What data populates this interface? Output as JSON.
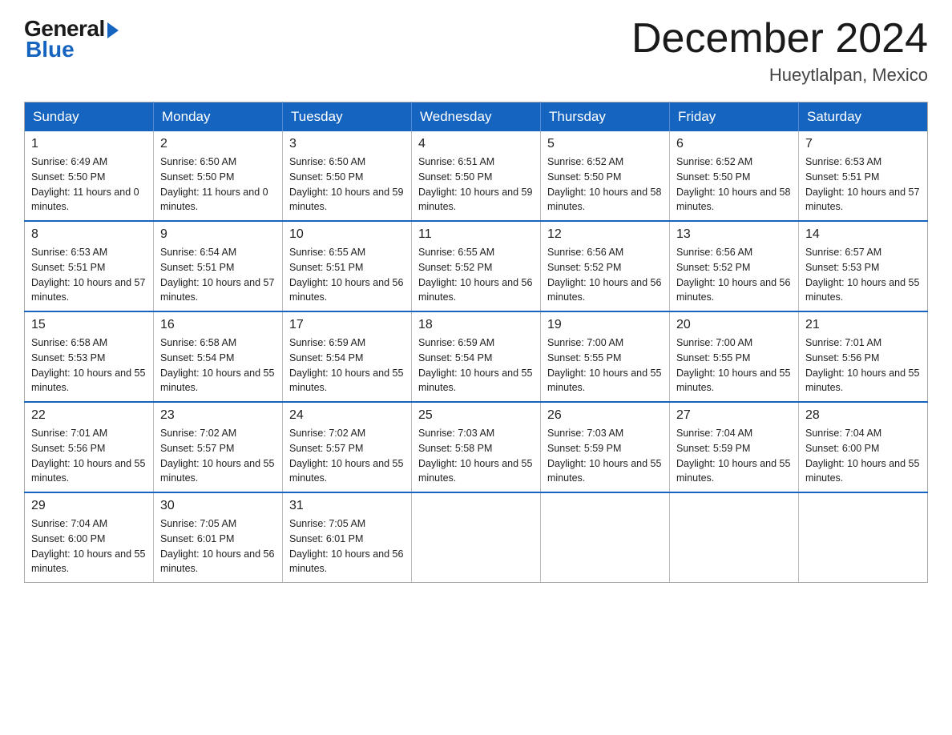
{
  "logo": {
    "general": "General",
    "blue": "Blue"
  },
  "title": "December 2024",
  "location": "Hueytlalpan, Mexico",
  "days_of_week": [
    "Sunday",
    "Monday",
    "Tuesday",
    "Wednesday",
    "Thursday",
    "Friday",
    "Saturday"
  ],
  "weeks": [
    [
      {
        "day": "1",
        "sunrise": "6:49 AM",
        "sunset": "5:50 PM",
        "daylight": "11 hours and 0 minutes."
      },
      {
        "day": "2",
        "sunrise": "6:50 AM",
        "sunset": "5:50 PM",
        "daylight": "11 hours and 0 minutes."
      },
      {
        "day": "3",
        "sunrise": "6:50 AM",
        "sunset": "5:50 PM",
        "daylight": "10 hours and 59 minutes."
      },
      {
        "day": "4",
        "sunrise": "6:51 AM",
        "sunset": "5:50 PM",
        "daylight": "10 hours and 59 minutes."
      },
      {
        "day": "5",
        "sunrise": "6:52 AM",
        "sunset": "5:50 PM",
        "daylight": "10 hours and 58 minutes."
      },
      {
        "day": "6",
        "sunrise": "6:52 AM",
        "sunset": "5:50 PM",
        "daylight": "10 hours and 58 minutes."
      },
      {
        "day": "7",
        "sunrise": "6:53 AM",
        "sunset": "5:51 PM",
        "daylight": "10 hours and 57 minutes."
      }
    ],
    [
      {
        "day": "8",
        "sunrise": "6:53 AM",
        "sunset": "5:51 PM",
        "daylight": "10 hours and 57 minutes."
      },
      {
        "day": "9",
        "sunrise": "6:54 AM",
        "sunset": "5:51 PM",
        "daylight": "10 hours and 57 minutes."
      },
      {
        "day": "10",
        "sunrise": "6:55 AM",
        "sunset": "5:51 PM",
        "daylight": "10 hours and 56 minutes."
      },
      {
        "day": "11",
        "sunrise": "6:55 AM",
        "sunset": "5:52 PM",
        "daylight": "10 hours and 56 minutes."
      },
      {
        "day": "12",
        "sunrise": "6:56 AM",
        "sunset": "5:52 PM",
        "daylight": "10 hours and 56 minutes."
      },
      {
        "day": "13",
        "sunrise": "6:56 AM",
        "sunset": "5:52 PM",
        "daylight": "10 hours and 56 minutes."
      },
      {
        "day": "14",
        "sunrise": "6:57 AM",
        "sunset": "5:53 PM",
        "daylight": "10 hours and 55 minutes."
      }
    ],
    [
      {
        "day": "15",
        "sunrise": "6:58 AM",
        "sunset": "5:53 PM",
        "daylight": "10 hours and 55 minutes."
      },
      {
        "day": "16",
        "sunrise": "6:58 AM",
        "sunset": "5:54 PM",
        "daylight": "10 hours and 55 minutes."
      },
      {
        "day": "17",
        "sunrise": "6:59 AM",
        "sunset": "5:54 PM",
        "daylight": "10 hours and 55 minutes."
      },
      {
        "day": "18",
        "sunrise": "6:59 AM",
        "sunset": "5:54 PM",
        "daylight": "10 hours and 55 minutes."
      },
      {
        "day": "19",
        "sunrise": "7:00 AM",
        "sunset": "5:55 PM",
        "daylight": "10 hours and 55 minutes."
      },
      {
        "day": "20",
        "sunrise": "7:00 AM",
        "sunset": "5:55 PM",
        "daylight": "10 hours and 55 minutes."
      },
      {
        "day": "21",
        "sunrise": "7:01 AM",
        "sunset": "5:56 PM",
        "daylight": "10 hours and 55 minutes."
      }
    ],
    [
      {
        "day": "22",
        "sunrise": "7:01 AM",
        "sunset": "5:56 PM",
        "daylight": "10 hours and 55 minutes."
      },
      {
        "day": "23",
        "sunrise": "7:02 AM",
        "sunset": "5:57 PM",
        "daylight": "10 hours and 55 minutes."
      },
      {
        "day": "24",
        "sunrise": "7:02 AM",
        "sunset": "5:57 PM",
        "daylight": "10 hours and 55 minutes."
      },
      {
        "day": "25",
        "sunrise": "7:03 AM",
        "sunset": "5:58 PM",
        "daylight": "10 hours and 55 minutes."
      },
      {
        "day": "26",
        "sunrise": "7:03 AM",
        "sunset": "5:59 PM",
        "daylight": "10 hours and 55 minutes."
      },
      {
        "day": "27",
        "sunrise": "7:04 AM",
        "sunset": "5:59 PM",
        "daylight": "10 hours and 55 minutes."
      },
      {
        "day": "28",
        "sunrise": "7:04 AM",
        "sunset": "6:00 PM",
        "daylight": "10 hours and 55 minutes."
      }
    ],
    [
      {
        "day": "29",
        "sunrise": "7:04 AM",
        "sunset": "6:00 PM",
        "daylight": "10 hours and 55 minutes."
      },
      {
        "day": "30",
        "sunrise": "7:05 AM",
        "sunset": "6:01 PM",
        "daylight": "10 hours and 56 minutes."
      },
      {
        "day": "31",
        "sunrise": "7:05 AM",
        "sunset": "6:01 PM",
        "daylight": "10 hours and 56 minutes."
      },
      null,
      null,
      null,
      null
    ]
  ]
}
